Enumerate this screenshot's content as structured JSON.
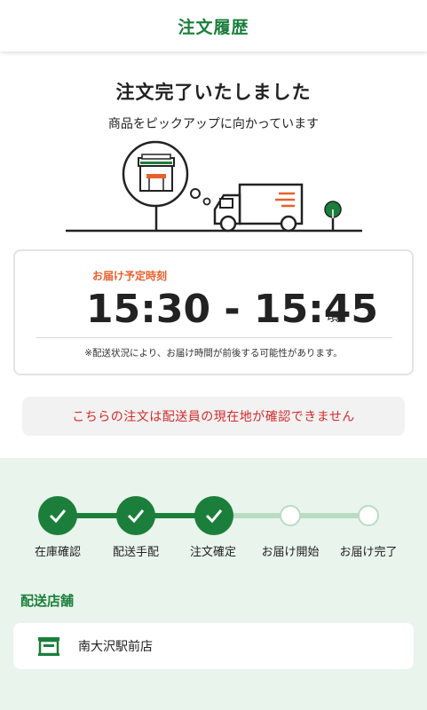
{
  "header": {
    "title": "注文履歴"
  },
  "status": {
    "title": "注文完了いたしました",
    "subtitle": "商品をピックアップに向かっています"
  },
  "delivery": {
    "label": "お届け予定時刻",
    "time_range": "15:30 - 15:45",
    "suffix": "頃",
    "note": "※配送状況により、お届け時間が前後する可能性があります。"
  },
  "warning": {
    "text": "こちらの注文は配送員の現在地が確認できません"
  },
  "progress": {
    "completed_count": 3,
    "steps": [
      {
        "label": "在庫確認",
        "done": true
      },
      {
        "label": "配送手配",
        "done": true
      },
      {
        "label": "注文確定",
        "done": true
      },
      {
        "label": "お届け開始",
        "done": false
      },
      {
        "label": "お届け完了",
        "done": false
      }
    ]
  },
  "shop": {
    "heading": "配送店舗",
    "name": "南大沢駅前店",
    "icon": "store-icon"
  },
  "colors": {
    "brand_green": "#1b7f3b",
    "accent_orange": "#e8602c",
    "warning_red": "#d42a2a",
    "progress_bg": "#e9f4ec",
    "pending_green": "#b9dcc3"
  }
}
